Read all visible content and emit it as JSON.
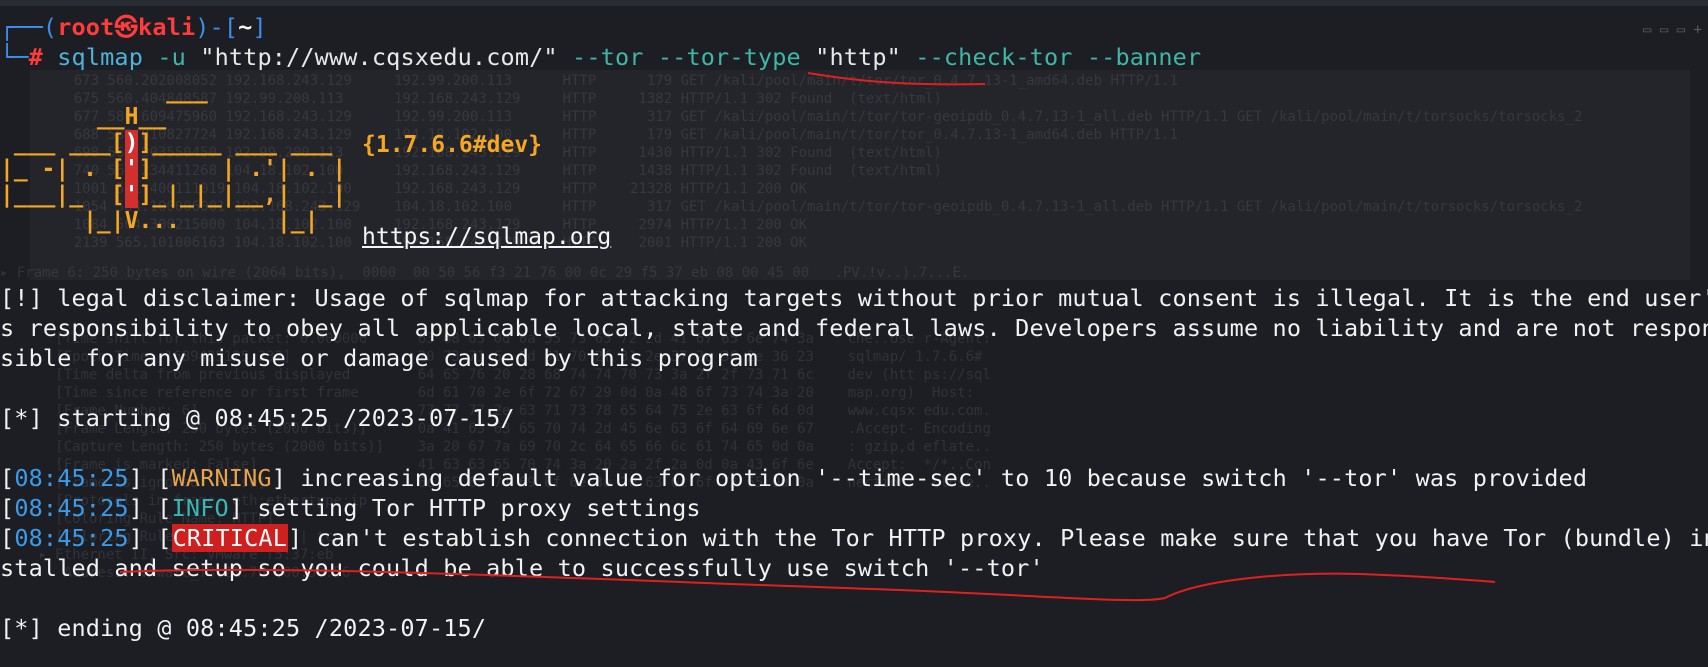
{
  "prompt": {
    "corner_top": "┌──(",
    "user": "root㉿kali",
    "mid": ")-[",
    "dir": "~",
    "end": "]",
    "corner_bottom": "└─",
    "hash": "#"
  },
  "command": {
    "program": "sqlmap",
    "flag_u": "-u",
    "url_arg": "\"http://www.cqsxedu.com/\"",
    "flag_tor": "--tor",
    "flag_tor_type": "--tor-type",
    "tor_type_val": "\"http\"",
    "flag_check_tor": "--check-tor",
    "flag_banner": "--banner"
  },
  "banner": {
    "version": "{1.7.6.6#dev}",
    "site": "https://sqlmap.org"
  },
  "output": {
    "disclaimer_1": "[!] legal disclaimer: Usage of sqlmap for attacking targets without prior mutual consent is illegal. It is the end user'",
    "disclaimer_2": "s responsibility to obey all applicable local, state and federal laws. Developers assume no liability and are not respon",
    "disclaimer_3": "sible for any misuse or damage caused by this program",
    "starting": "[*] starting @ 08:45:25 /2023-07-15/",
    "log": [
      {
        "time": "08:45:25",
        "level": "WARNING",
        "msg": " increasing default value for option '--time-sec' to 10 because switch '--tor' was provided"
      },
      {
        "time": "08:45:25",
        "level": "INFO",
        "msg": " setting Tor HTTP proxy settings"
      },
      {
        "time": "08:45:25",
        "level": "CRITICAL",
        "msg": " can't establish connection with the Tor HTTP proxy. Please make sure that you have Tor (bundle) in"
      }
    ],
    "critical_cont": "stalled and setup so you could be able to successfully use switch '--tor'",
    "ending": "[*] ending @ 08:45:25 /2023-07-15/"
  },
  "colors": {
    "background": "#1c1e24",
    "prompt_blue": "#3b8eea",
    "prompt_red": "#ff3b3b",
    "banner_orange": "#f5a623",
    "critical_bg": "#d01f1f",
    "annotation_red": "#e0201e"
  }
}
